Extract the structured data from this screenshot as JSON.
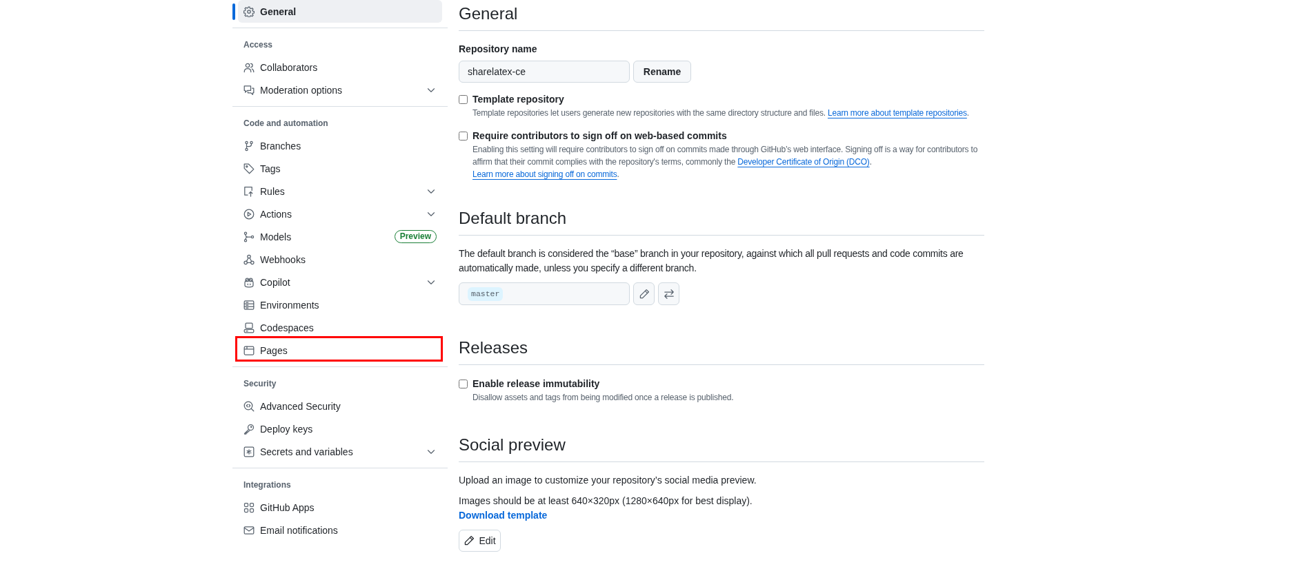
{
  "sidebar": {
    "groups": [
      {
        "items": [
          {
            "label": "General",
            "selected": true,
            "expandable": false,
            "highlighted": false
          }
        ]
      },
      {
        "heading": "Access",
        "items": [
          {
            "label": "Collaborators",
            "selected": false,
            "expandable": false,
            "highlighted": false
          },
          {
            "label": "Moderation options",
            "selected": false,
            "expandable": true,
            "highlighted": false
          }
        ]
      },
      {
        "heading": "Code and automation",
        "items": [
          {
            "label": "Branches",
            "selected": false,
            "expandable": false,
            "highlighted": false
          },
          {
            "label": "Tags",
            "selected": false,
            "expandable": false,
            "highlighted": false
          },
          {
            "label": "Rules",
            "selected": false,
            "expandable": true,
            "highlighted": false
          },
          {
            "label": "Actions",
            "selected": false,
            "expandable": true,
            "highlighted": false
          },
          {
            "label": "Models",
            "selected": false,
            "expandable": false,
            "highlighted": false,
            "badge": "Preview"
          },
          {
            "label": "Webhooks",
            "selected": false,
            "expandable": false,
            "highlighted": false
          },
          {
            "label": "Copilot",
            "selected": false,
            "expandable": true,
            "highlighted": false
          },
          {
            "label": "Environments",
            "selected": false,
            "expandable": false,
            "highlighted": false
          },
          {
            "label": "Codespaces",
            "selected": false,
            "expandable": false,
            "highlighted": false
          },
          {
            "label": "Pages",
            "selected": false,
            "expandable": false,
            "highlighted": true
          }
        ]
      },
      {
        "heading": "Security",
        "items": [
          {
            "label": "Advanced Security",
            "selected": false,
            "expandable": false,
            "highlighted": false
          },
          {
            "label": "Deploy keys",
            "selected": false,
            "expandable": false,
            "highlighted": false
          },
          {
            "label": "Secrets and variables",
            "selected": false,
            "expandable": true,
            "highlighted": false
          }
        ]
      },
      {
        "heading": "Integrations",
        "items": [
          {
            "label": "GitHub Apps",
            "selected": false,
            "expandable": false,
            "highlighted": false
          },
          {
            "label": "Email notifications",
            "selected": false,
            "expandable": false,
            "highlighted": false
          }
        ]
      }
    ]
  },
  "general": {
    "title": "General",
    "repo_name": {
      "label": "Repository name",
      "value": "sharelatex-ce"
    },
    "rename_button": "Rename",
    "options": [
      {
        "label": "Template repository",
        "checked": false,
        "description": [
          {
            "kind": "text",
            "text": "Template repositories let users generate new repositories with the same directory structure and files. "
          },
          {
            "kind": "link",
            "text": "Learn more about template repositories"
          },
          {
            "kind": "text",
            "text": "."
          }
        ]
      },
      {
        "label": "Require contributors to sign off on web-based commits",
        "checked": false,
        "description": [
          {
            "kind": "text",
            "text": "Enabling this setting will require contributors to sign off on commits made through GitHub’s web interface. Signing off is a way for contributors to affirm that their commit complies with the repository's terms, commonly the "
          },
          {
            "kind": "link",
            "text": "Developer Certificate of Origin (DCO)"
          },
          {
            "kind": "text",
            "text": ". "
          },
          {
            "kind": "link",
            "text": "Learn more about signing off on commits"
          },
          {
            "kind": "text",
            "text": "."
          }
        ]
      }
    ]
  },
  "default_branch": {
    "title": "Default branch",
    "description": "The default branch is considered the “base” branch in your repository, against which all pull requests and code commits are automatically made, unless you specify a different branch.",
    "branch": "master"
  },
  "releases": {
    "title": "Releases",
    "options": [
      {
        "label": "Enable release immutability",
        "checked": false,
        "description": [
          {
            "kind": "text",
            "text": "Disallow assets and tags from being modified once a release is published."
          }
        ]
      }
    ]
  },
  "social_preview": {
    "title": "Social preview",
    "intro": "Upload an image to customize your repository’s social media preview.",
    "size_note": "Images should be at least 640×320px (1280×640px for best display).",
    "download_link": "Download template",
    "edit_button": "Edit"
  }
}
